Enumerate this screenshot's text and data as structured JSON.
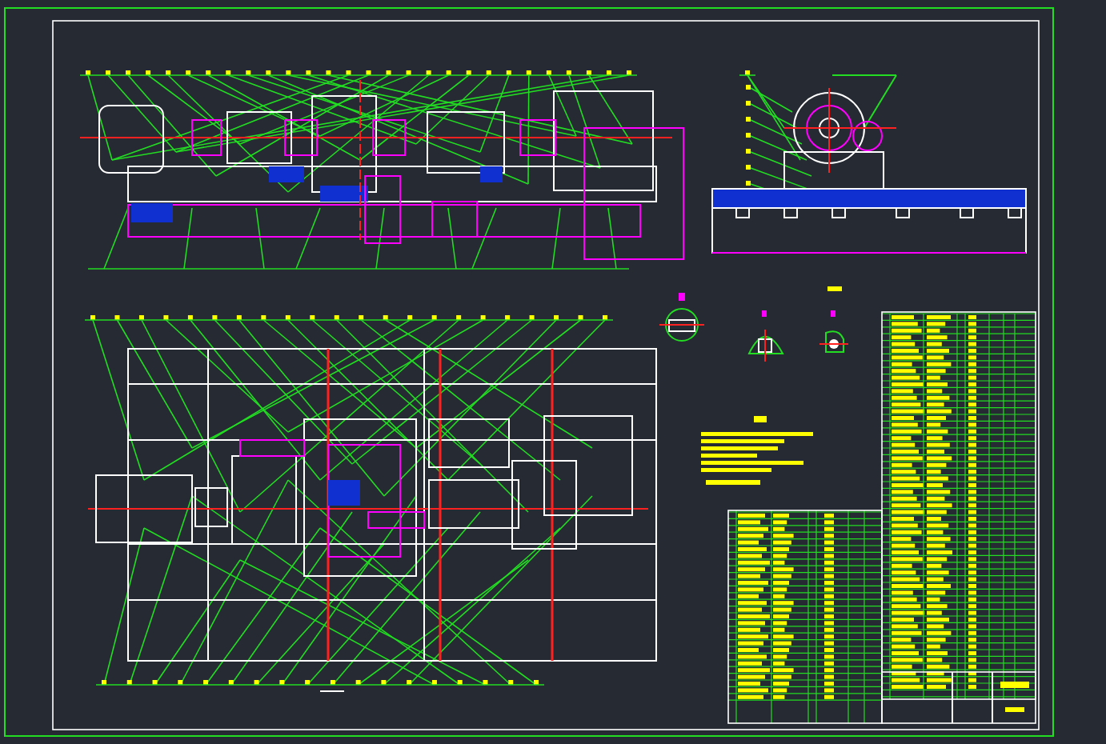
{
  "sheet": {
    "views": [
      {
        "kind": "front-elevation"
      },
      {
        "kind": "side-elevation"
      },
      {
        "kind": "plan-view"
      },
      {
        "kind": "detail-a"
      },
      {
        "kind": "detail-b"
      },
      {
        "kind": "detail-c"
      },
      {
        "kind": "notes"
      },
      {
        "kind": "parts-list"
      }
    ]
  }
}
